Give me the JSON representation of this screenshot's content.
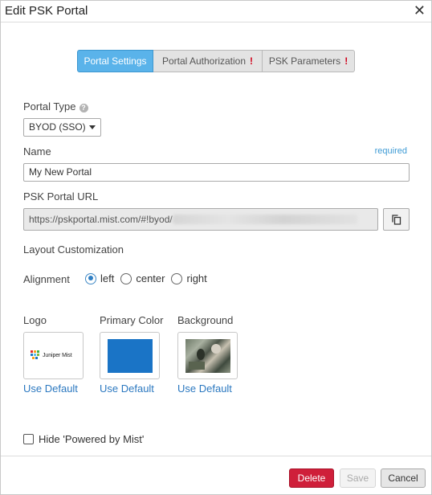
{
  "dialog": {
    "title": "Edit PSK Portal"
  },
  "tabs": [
    {
      "label": "Portal Settings",
      "active": true,
      "warning": ""
    },
    {
      "label": "Portal Authorization",
      "active": false,
      "warning": "!"
    },
    {
      "label": "PSK Parameters",
      "active": false,
      "warning": "!"
    }
  ],
  "form": {
    "portal_type_label": "Portal Type",
    "portal_type_value": "BYOD (SSO)",
    "name_label": "Name",
    "name_required": "required",
    "name_value": "My New Portal",
    "url_label": "PSK Portal URL",
    "url_value": "https://pskportal.mist.com/#!byod/",
    "layout_heading": "Layout Customization",
    "alignment_label": "Alignment",
    "alignment_options": [
      "left",
      "center",
      "right"
    ],
    "alignment_selected": "left",
    "logo_label": "Logo",
    "logo_text": "Juniper Mist",
    "primary_color_label": "Primary Color",
    "primary_color": "#1a74c6",
    "background_label": "Background",
    "use_default": "Use Default",
    "hide_powered_label": "Hide 'Powered by Mist'",
    "hide_powered_checked": false
  },
  "buttons": {
    "delete": "Delete",
    "save": "Save",
    "cancel": "Cancel"
  },
  "colors": {
    "active_tab": "#5ab3ea",
    "link": "#2b78c0",
    "delete": "#cf1f3a",
    "warning": "#d0021b"
  },
  "icons": {
    "close": "close-icon",
    "help": "help-icon",
    "copy": "copy-icon",
    "dropdown": "chevron-down-icon"
  }
}
